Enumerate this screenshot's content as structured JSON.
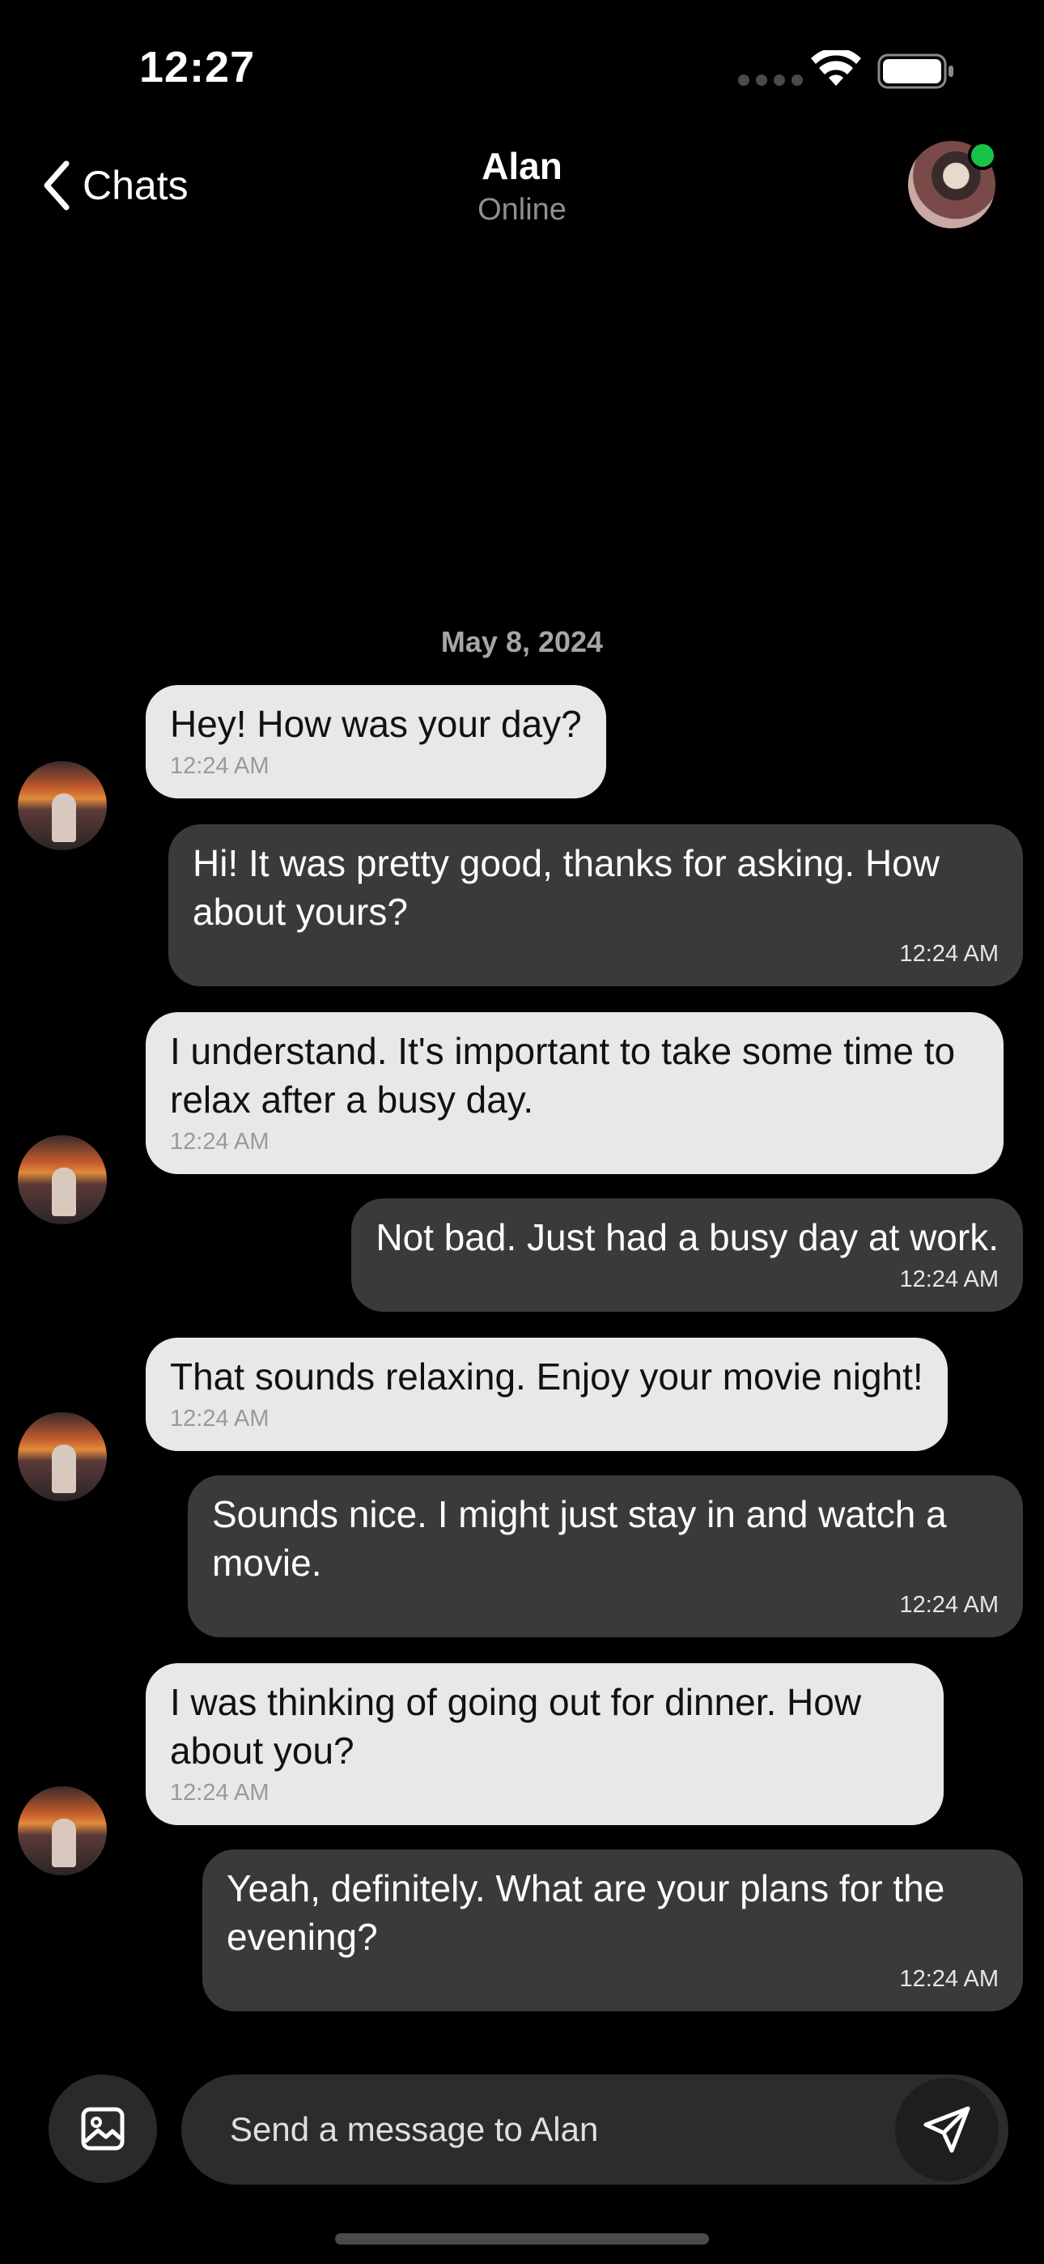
{
  "status_bar": {
    "time": "12:27"
  },
  "header": {
    "back_label": "Chats",
    "contact_name": "Alan",
    "contact_status": "Online",
    "online_color": "#19c34a"
  },
  "chat": {
    "date": "May 8, 2024",
    "messages": [
      {
        "direction": "incoming",
        "text": "Hey! How was your day?",
        "time": "12:24 AM"
      },
      {
        "direction": "outgoing",
        "text": "Hi! It was pretty good, thanks for asking. How about yours?",
        "time": "12:24 AM"
      },
      {
        "direction": "incoming",
        "text": "I understand. It's important to take some time to relax after a busy day.",
        "time": "12:24 AM"
      },
      {
        "direction": "outgoing",
        "text": "Not bad. Just had a busy day at work.",
        "time": "12:24 AM"
      },
      {
        "direction": "incoming",
        "text": "That sounds relaxing. Enjoy your movie night!",
        "time": "12:24 AM"
      },
      {
        "direction": "outgoing",
        "text": "Sounds nice. I might just stay in and watch a movie.",
        "time": "12:24 AM"
      },
      {
        "direction": "incoming",
        "text": "I was thinking of going out for dinner. How about you?",
        "time": "12:24 AM"
      },
      {
        "direction": "outgoing",
        "text": "Yeah, definitely. What are your plans for the evening?",
        "time": "12:24 AM"
      }
    ]
  },
  "composer": {
    "placeholder": "Send a message to Alan",
    "attach_icon": "image-icon",
    "send_icon": "send-icon"
  }
}
